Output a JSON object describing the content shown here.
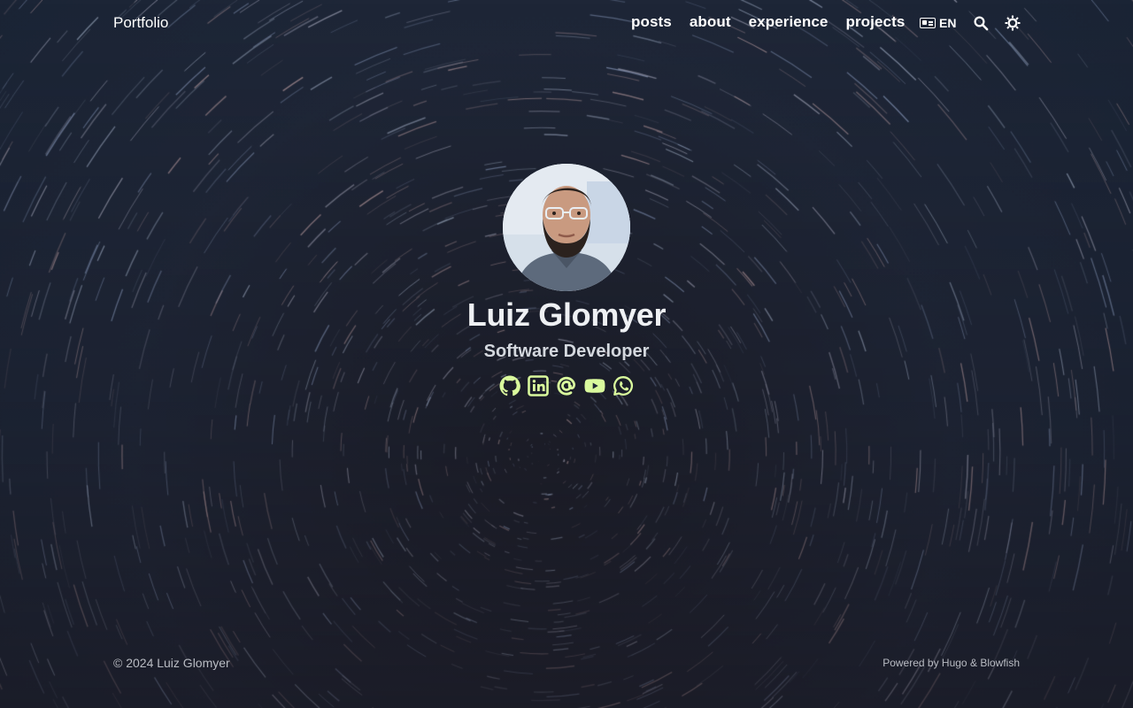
{
  "header": {
    "brand": "Portfolio",
    "nav": [
      "posts",
      "about",
      "experience",
      "projects"
    ],
    "language": "EN",
    "icons": {
      "language": "language-icon",
      "search": "search-icon",
      "theme": "sun-icon"
    }
  },
  "profile": {
    "name": "Luiz Glomyer",
    "role": "Software Developer",
    "socials": [
      "github-icon",
      "linkedin-icon",
      "email-icon",
      "youtube-icon",
      "whatsapp-icon"
    ],
    "accent": "#d9f99d"
  },
  "footer": {
    "copyright": "© 2024 Luiz Glomyer",
    "powered_prefix": "Powered by",
    "hugo": "Hugo",
    "amp": "&",
    "blowfish": "Blowfish"
  },
  "colors": {
    "background": "#1c2230",
    "text": "#ffffff",
    "muted": "#b9bcc3"
  }
}
